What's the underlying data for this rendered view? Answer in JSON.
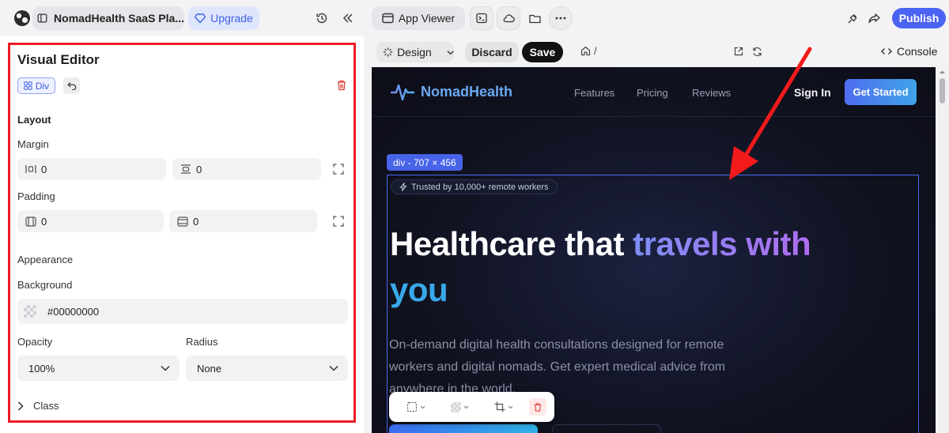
{
  "topbar": {
    "project_name": "NomadHealth SaaS Pla...",
    "upgrade_label": "Upgrade",
    "app_viewer_label": "App Viewer",
    "publish_label": "Publish"
  },
  "editor": {
    "title": "Visual Editor",
    "element_badge": "Div",
    "layout_heading": "Layout",
    "margin_label": "Margin",
    "margin_horizontal": "0",
    "margin_vertical": "0",
    "padding_label": "Padding",
    "padding_horizontal": "0",
    "padding_vertical": "0",
    "appearance_heading": "Appearance",
    "background_label": "Background",
    "background_value": "#00000000",
    "opacity_label": "Opacity",
    "opacity_value": "100%",
    "radius_label": "Radius",
    "radius_value": "None",
    "class_label": "Class"
  },
  "preview_toolbar": {
    "design_label": "Design",
    "discard_label": "Discard",
    "save_label": "Save",
    "route": "/",
    "console_label": "Console"
  },
  "site": {
    "brand": "NomadHealth",
    "nav": [
      "Features",
      "Pricing",
      "Reviews"
    ],
    "sign_in": "Sign In",
    "get_started": "Get Started",
    "selection_tag": "div - 707 × 456",
    "trust_badge": "Trusted by 10,000+ remote workers",
    "hero_line1_plain": "Healthcare that ",
    "hero_line1_accent": "travels with",
    "hero_line2": "you",
    "hero_sub": "On-demand digital health consultations designed for remote workers and digital nomads. Get expert medical advice from anywhere in the world."
  },
  "colors": {
    "accent": "#4b63f2",
    "danger": "#ec1c24",
    "preview_bg": "#10121f"
  }
}
